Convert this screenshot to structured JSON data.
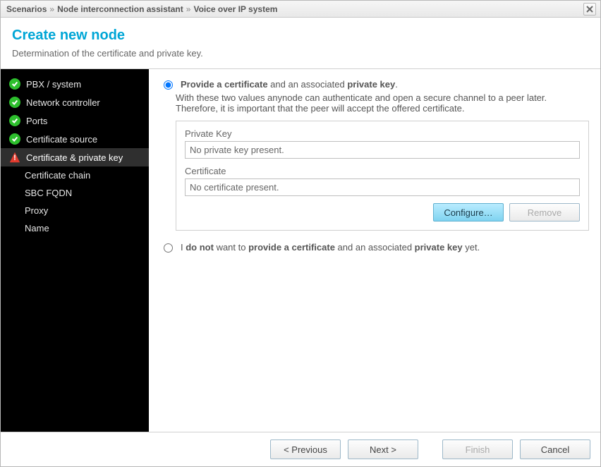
{
  "titlebar": {
    "crumb1": "Scenarios",
    "crumb2": "Node interconnection assistant",
    "crumb3": "Voice over IP system",
    "sep": "»"
  },
  "header": {
    "title": "Create new node",
    "subtitle": "Determination of the certificate and private key."
  },
  "sidebar": {
    "items": [
      {
        "label": "PBX / system",
        "status": "ok"
      },
      {
        "label": "Network controller",
        "status": "ok"
      },
      {
        "label": "Ports",
        "status": "ok"
      },
      {
        "label": "Certificate source",
        "status": "ok"
      },
      {
        "label": "Certificate & private key",
        "status": "warn",
        "active": true
      },
      {
        "label": "Certificate chain",
        "status": "none"
      },
      {
        "label": "SBC FQDN",
        "status": "none"
      },
      {
        "label": "Proxy",
        "status": "none"
      },
      {
        "label": "Name",
        "status": "none"
      }
    ]
  },
  "option1": {
    "lead": "Provide a certificate",
    "mid": " and an associated ",
    "tail": "private key",
    "after": ".",
    "desc": "With these two values anynode can authenticate and open a secure channel to a peer later. Therefore, it is important that the peer will accept the offered certificate.",
    "privKeyLabel": "Private Key",
    "privKeyValue": "No private key present.",
    "certLabel": "Certificate",
    "certValue": "No certificate present.",
    "configure": "Configure…",
    "remove": "Remove"
  },
  "option2": {
    "pre": "I ",
    "bold1": "do not",
    "mid1": " want to ",
    "bold2": "provide a certificate",
    "mid2": " and an associated ",
    "bold3": "private key",
    "after": " yet."
  },
  "footer": {
    "prev": "< Previous",
    "next": "Next >",
    "finish": "Finish",
    "cancel": "Cancel"
  }
}
